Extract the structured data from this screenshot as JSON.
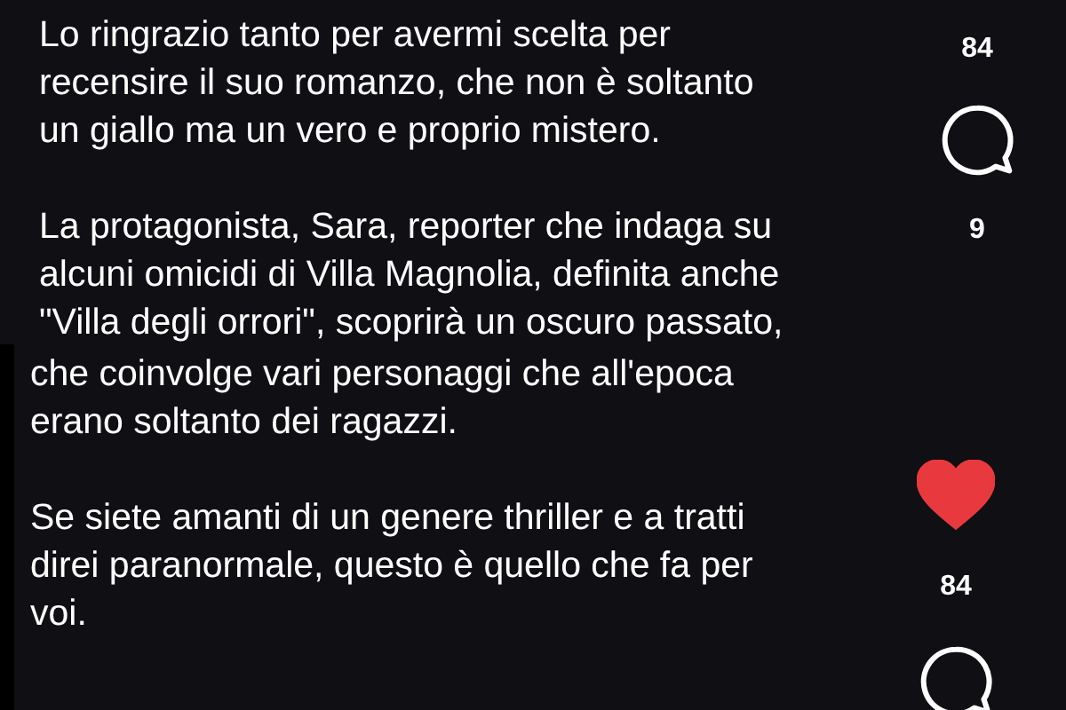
{
  "panels": [
    {
      "paragraphs": [
        {
          "lines": [
            "Lo ringrazio tanto per avermi scelta per",
            "recensire il suo romanzo, che non è soltanto",
            "un giallo ma un vero e proprio mistero."
          ]
        },
        {
          "lines": [
            "La protagonista, Sara, reporter che indaga su",
            "alcuni omicidi di Villa Magnolia, definita anche",
            "\"Villa degli orrori\", scoprirà un oscuro passato,"
          ]
        }
      ],
      "actions": [
        {
          "kind": "count",
          "text": "84"
        },
        {
          "kind": "comment"
        },
        {
          "kind": "count",
          "text": "9"
        }
      ]
    },
    {
      "paragraphs": [
        {
          "lines": [
            "che coinvolge vari personaggi che all'epoca",
            "erano soltanto dei ragazzi."
          ]
        },
        {
          "lines": [
            "Se siete amanti di un genere thriller e a tratti",
            "direi paranormale, questo è quello che fa per",
            "voi."
          ]
        }
      ],
      "actions": [
        {
          "kind": "like",
          "liked": true
        },
        {
          "kind": "count",
          "text": "84"
        },
        {
          "kind": "comment"
        }
      ]
    }
  ]
}
